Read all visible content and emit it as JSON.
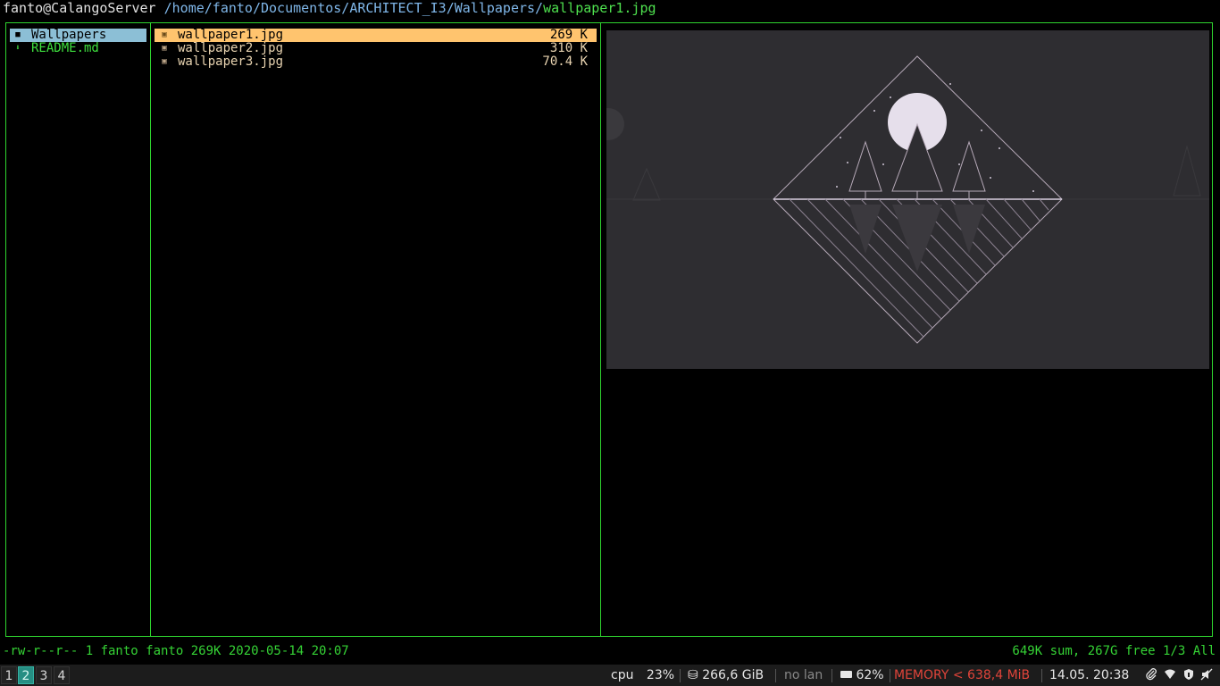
{
  "titlebar": {
    "host": "fanto@CalangoServer",
    "path": "/home/fanto/Documentos/ARCHITECT_I3/Wallpapers/",
    "file": "wallpaper1.jpg"
  },
  "parent_pane": {
    "items": [
      {
        "label": "Wallpapers",
        "icon": "folder-icon"
      },
      {
        "label": "README.md",
        "icon": "download-file-icon"
      }
    ]
  },
  "current_pane": {
    "files": [
      {
        "name": "wallpaper1.jpg",
        "size": "269 K",
        "selected": true
      },
      {
        "name": "wallpaper2.jpg",
        "size": "310 K",
        "selected": false
      },
      {
        "name": "wallpaper3.jpg",
        "size": "70.4 K",
        "selected": false
      }
    ]
  },
  "status": {
    "file_info": "-rw-r--r-- 1 fanto fanto 269K 2020-05-14 20:07",
    "summary": "649K sum, 267G free  1/3  All"
  },
  "i3bar": {
    "workspaces": [
      "1",
      "2",
      "3",
      "4"
    ],
    "active_workspace": "2",
    "cpu_label": "cpu",
    "cpu_value": "23%",
    "disk_value": "266,6 GiB",
    "lan": "no lan",
    "battery": "62%",
    "memory": "MEMORY < 638,4 MiB",
    "datetime": "14.05. 20:38",
    "colors": {
      "memory": "#e0443a",
      "lan": "#888888",
      "accent": "#2fd42f",
      "selection": "#ffc46e",
      "active_workspace": "#268e83"
    }
  }
}
